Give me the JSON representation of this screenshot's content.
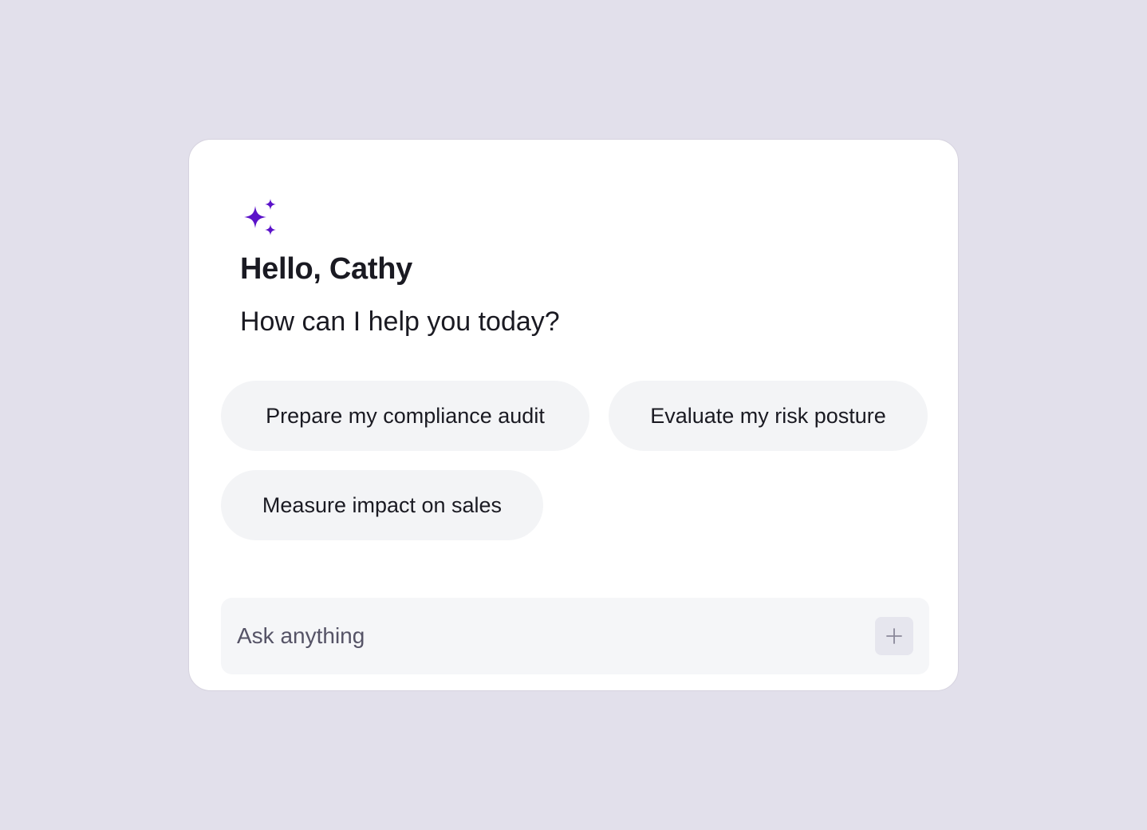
{
  "assistant": {
    "icon": "sparkles-icon",
    "accent_color": "#5b12c9",
    "greeting": "Hello, Cathy",
    "subtitle": "How can I help you today?"
  },
  "suggestions": [
    {
      "label": "Prepare my compliance audit"
    },
    {
      "label": "Evaluate my risk posture"
    },
    {
      "label": "Measure impact on sales"
    }
  ],
  "composer": {
    "placeholder": "Ask anything",
    "value": "",
    "add_icon": "plus-icon"
  }
}
